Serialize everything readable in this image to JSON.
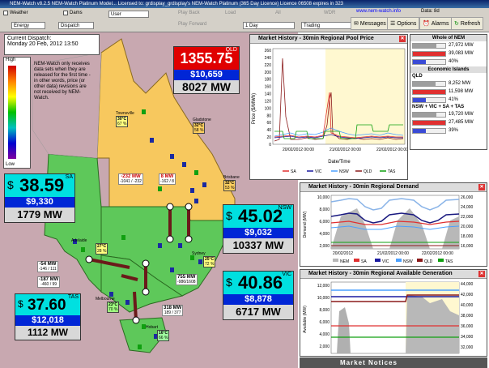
{
  "title": "NEM-Watch v8.2.5 NEM-Watch Platinum Model...   Licensed to: grdisplay_grdisplay's NEM-Watch Platinum (365 Day Licence) Licence 06508 expires in 323",
  "toolbar": {
    "weather": "Weather",
    "dams": "Dams",
    "user_select": "User",
    "energy_select": "Energy",
    "dispatch_select": "Dispatch",
    "play_back": "Play Back",
    "play_forward": "Play Forward",
    "load": "Load",
    "all": "All",
    "wdr": "WDR",
    "period_select": "1 Day",
    "trading_select": "Trading",
    "messages": "Messages",
    "options": "Options",
    "alarms": "Alarms",
    "refresh": "Refresh",
    "brand": "www.nem-watch.info",
    "data_label": "Data: 8d"
  },
  "dispatch": {
    "label": "Current Dispatch:",
    "datetime": "Monday 20 Feb, 2012 13:50"
  },
  "note": "NEM-Watch only receives data sets when they are released for the first time - in other words, price (or other data) revisions are not received by NEM-Watch.",
  "scale": {
    "high": "High",
    "low": "Low"
  },
  "regions": {
    "qld": {
      "name": "QLD",
      "price": "1355.75",
      "demand": "$10,659",
      "mw": "8027 MW"
    },
    "sa": {
      "name": "SA",
      "dollar": "$",
      "price": "38.59",
      "demand": "$9,330",
      "mw": "1779 MW"
    },
    "nsw": {
      "name": "NSW",
      "dollar": "$",
      "price": "45.02",
      "demand": "$9,032",
      "mw": "10337 MW"
    },
    "vic": {
      "name": "VIC",
      "dollar": "$",
      "price": "40.86",
      "demand": "$8,878",
      "mw": "6717 MW"
    },
    "tas": {
      "name": "TAS",
      "dollar": "$",
      "price": "37.60",
      "demand": "$12,018",
      "mw": "1112 MW"
    }
  },
  "cities": [
    {
      "name": "Townsville",
      "temp": "30°C",
      "hum": "67 %"
    },
    {
      "name": "Gladstone",
      "temp": "32°C",
      "hum": "58 %"
    },
    {
      "name": "Brisbane",
      "temp": "32°C",
      "hum": "53 %"
    },
    {
      "name": "Adelaide",
      "temp": "27°C",
      "hum": "28 %"
    },
    {
      "name": "Sydney",
      "temp": "25°C",
      "hum": "72 %"
    },
    {
      "name": "Melbourne",
      "temp": "23°C",
      "hum": "70 %"
    },
    {
      "name": "Hobart",
      "temp": "16°C",
      "hum": "66 %"
    }
  ],
  "flows": [
    {
      "mw": "-232 MW",
      "lim": "-1041 / -232"
    },
    {
      "mw": "8 MW",
      "lim": "-162 / 8"
    },
    {
      "mw": "-54 MW",
      "lim": "-146 / 111"
    },
    {
      "mw": "-187 MW",
      "lim": "-460 / 99"
    },
    {
      "mw": "755 MW",
      "lim": "-986/1608"
    },
    {
      "mw": "318 MW",
      "lim": "189 / 377"
    }
  ],
  "nem_summary": {
    "whole": {
      "title": "Whole of NEM",
      "v1": "27,972 MW",
      "v2": "39,083 MW",
      "v3": "40%",
      "fill1": 0.72,
      "fill2": 1.0,
      "fill3": 0.4
    },
    "islands": {
      "title": "Economic Islands"
    },
    "qld": {
      "title": "QLD",
      "v1": "8,252 MW",
      "v2": "11,598 MW",
      "v3": "41%",
      "fill1": 0.71,
      "fill2": 1.0,
      "fill3": 0.41
    },
    "south": {
      "title": "NSW + VIC + SA + TAS",
      "v1": "19,720 MW",
      "v2": "27,485 MW",
      "v3": "39%",
      "fill1": 0.72,
      "fill2": 1.0,
      "fill3": 0.39
    }
  },
  "price_chart": {
    "title": "Market History - 30min Regional Pool Price",
    "ylabel": "Price ($/MWh)",
    "xlabel": "Date/Time",
    "yticks": [
      "260",
      "240",
      "220",
      "200",
      "180",
      "160",
      "140",
      "120",
      "100",
      "80",
      "60",
      "40",
      "20",
      "0"
    ],
    "xticks": [
      "20/02/2012 00:00",
      "21/02/2012 00:00",
      "22/02/2012 00:00"
    ],
    "legend": [
      "SA",
      "VIC",
      "NSW",
      "QLD",
      "TAS"
    ]
  },
  "demand_chart": {
    "title": "Market History - 30min Regional Demand",
    "ylabel": "Demand (MW)",
    "yticks_left": [
      "10,000",
      "8,000",
      "6,000",
      "4,000",
      "2,000"
    ],
    "yticks_right": [
      "26,000",
      "24,000",
      "22,000",
      "20,000",
      "18,000",
      "16,000"
    ],
    "xticks": [
      "20/02/2012",
      "21/02/2012 00:00",
      "22/02/2012 00:00"
    ],
    "legend": [
      "NEM",
      "SA",
      "VIC",
      "NSW",
      "QLD",
      "TAS"
    ]
  },
  "gen_chart": {
    "title": "Market History - 30min Regional Available Generation",
    "ylabel": "Available (MW)",
    "yticks_left": [
      "12,000",
      "10,000",
      "8,000",
      "6,000",
      "4,000",
      "2,000"
    ],
    "yticks_right": [
      "44,000",
      "42,000",
      "40,000",
      "38,000",
      "36,000",
      "34,000",
      "32,000"
    ]
  },
  "market_notices": "Market Notices",
  "colors": {
    "sa": "#e03030",
    "vic": "#1a1aa0",
    "nsw": "#4aa0ff",
    "qld": "#8b1a1a",
    "tas": "#10a010"
  }
}
